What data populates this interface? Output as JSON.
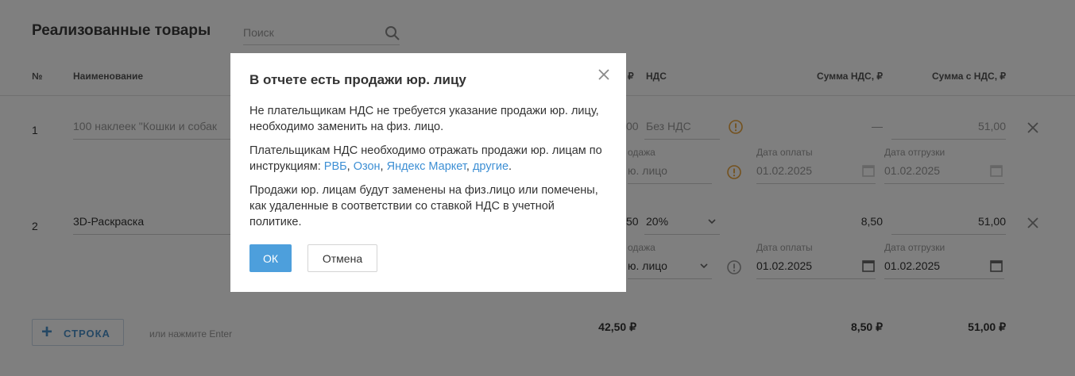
{
  "page": {
    "title": "Реализованные товары",
    "search_placeholder": "Поиск",
    "columns": {
      "num": "№",
      "name": "Наименование",
      "price_partial": "₽",
      "vat": "НДС",
      "vat_sum": "Сумма НДС, ₽",
      "total_with_vat": "Сумма с НДС, ₽"
    },
    "rows": [
      {
        "num": "1",
        "name": "100 наклеек \"Кошки и собак",
        "price_partial": "00",
        "vat": "Без НДС",
        "vat_sum": "—",
        "total": "51,00",
        "sale_label": "одажа",
        "sale_value": "ю. лицо",
        "pay_date_label": "Дата оплаты",
        "pay_date": "01.02.2025",
        "ship_date_label": "Дата отгрузки",
        "ship_date": "01.02.2025"
      },
      {
        "num": "2",
        "name": "3D-Раскраска",
        "price_partial": "50",
        "vat": "20%",
        "vat_sum": "8,50",
        "total": "51,00",
        "sale_label": "одажа",
        "sale_value": "ю. лицо",
        "pay_date_label": "Дата оплаты",
        "pay_date": "01.02.2025",
        "ship_date_label": "Дата отгрузки",
        "ship_date": "01.02.2025"
      }
    ],
    "add_row_label": "СТРОКА",
    "add_row_hint": "или нажмите Enter",
    "totals": {
      "price": "42,50 ₽",
      "vat_sum": "8,50 ₽",
      "total": "51,00 ₽"
    }
  },
  "modal": {
    "title": "В отчете есть продажи юр. лицу",
    "p1": "Не плательщикам НДС не требуется указание продажи юр. лицу, необходимо заменить на физ. лицо.",
    "p2_text": "Плательщикам НДС необходимо отражать продажи юр. лицам по инструкциям:",
    "links": {
      "wb": "РВБ",
      "ozon": "Озон",
      "ym": "Яндекс Маркет",
      "other": "другие"
    },
    "sep": ",",
    "end": ".",
    "p3": "Продажи юр. лицам будут заменены на физ.лицо или помечены, как удаленные в соответствии со ставкой НДС в учетной политике.",
    "ok_label": "ОК",
    "cancel_label": "Отмена"
  },
  "colors": {
    "accent": "#4d9fdc",
    "link": "#3d8fd4",
    "warning": "#e8a33a",
    "overlay": "rgba(0,0,0,0.5)"
  }
}
